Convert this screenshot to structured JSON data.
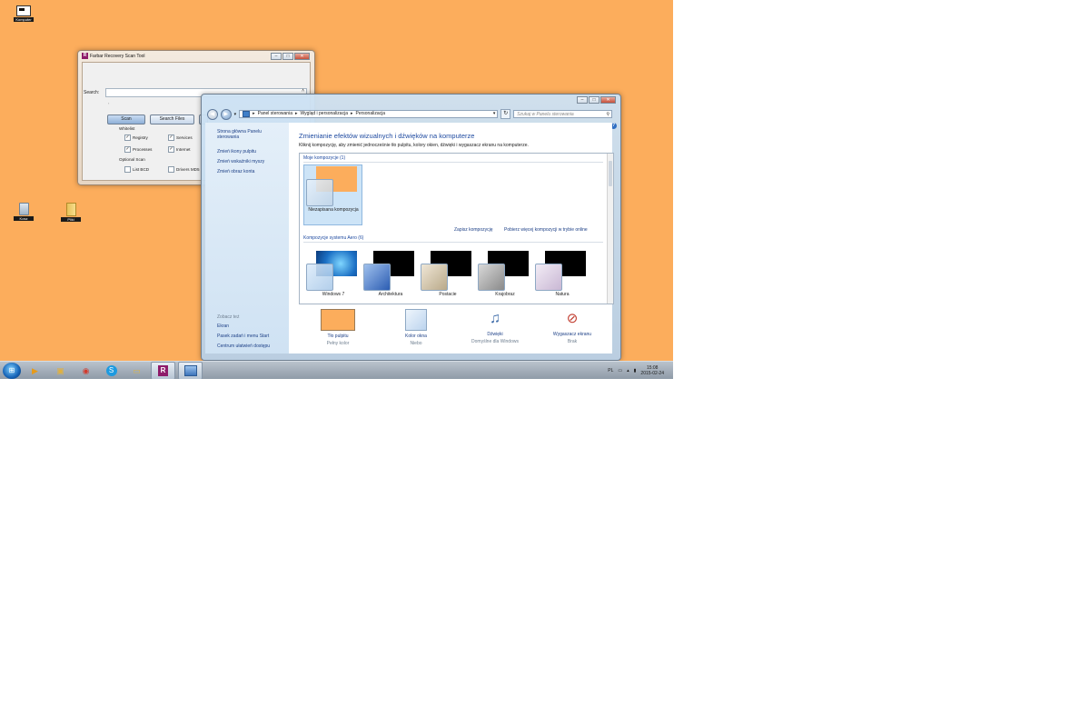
{
  "desktop": {
    "icons": [
      {
        "label": "Kosz"
      },
      {
        "label": "Komputer"
      },
      {
        "label": "Pliki"
      }
    ]
  },
  "frst": {
    "title": "Farbar Recovery Scan Tool",
    "search_label": "Search:",
    "scan_button": "Scan",
    "search_files_button": "Search Files",
    "whitelist_label": "Whitelist",
    "registry": "Registry",
    "services": "Services",
    "processes": "Processes",
    "internet": "Internet",
    "optional_scan_label": "Optional Scan",
    "list_bcd": "List BCD",
    "drivers_md5": "Drivers MD5"
  },
  "cp": {
    "breadcrumb": [
      "Panel sterowania",
      "Wygląd i personalizacja",
      "Personalizacja"
    ],
    "search_placeholder": "Szukaj w Panelu sterowania",
    "sidebar": {
      "home": "Strona główna Panelu sterowania",
      "links": [
        "Zmień ikony pulpitu",
        "Zmień wskaźniki myszy",
        "Zmień obraz konta"
      ],
      "see_also": "Zobacz też",
      "see_also_links": [
        "Ekran",
        "Pasek zadań i menu Start",
        "Centrum ułatwień dostępu"
      ]
    },
    "heading": "Zmienianie efektów wizualnych i dźwięków na komputerze",
    "description": "Kliknij kompozycję, aby zmienić jednocześnie tło pulpitu, kolory okien, dźwięki i wygaszacz ekranu na komputerze.",
    "my_themes_label": "Moje kompozycje (1)",
    "my_theme_name": "Niezapisana kompozycja",
    "save_theme_link": "Zapisz kompozycję",
    "more_themes_link": "Pobierz więcej kompozycji w trybie online",
    "aero_label": "Kompozycje systemu Aero (6)",
    "aero_themes": [
      "Windows 7",
      "Architektura",
      "Postacie",
      "Krajobraz",
      "Natura"
    ],
    "bottom": [
      {
        "title": "Tło pulpitu",
        "sub": "Pełny kolor"
      },
      {
        "title": "Kolor okna",
        "sub": "Niebo"
      },
      {
        "title": "Dźwięki",
        "sub": "Domyślne dla Windows"
      },
      {
        "title": "Wygaszacz ekranu",
        "sub": "Brak"
      }
    ]
  },
  "taskbar": {
    "lang": "PL",
    "time": "15:08",
    "date": "2015-02-24"
  },
  "colors": {
    "desktop": "#fcad5c",
    "link": "#1c3f86",
    "heading": "#1e4aa0"
  }
}
